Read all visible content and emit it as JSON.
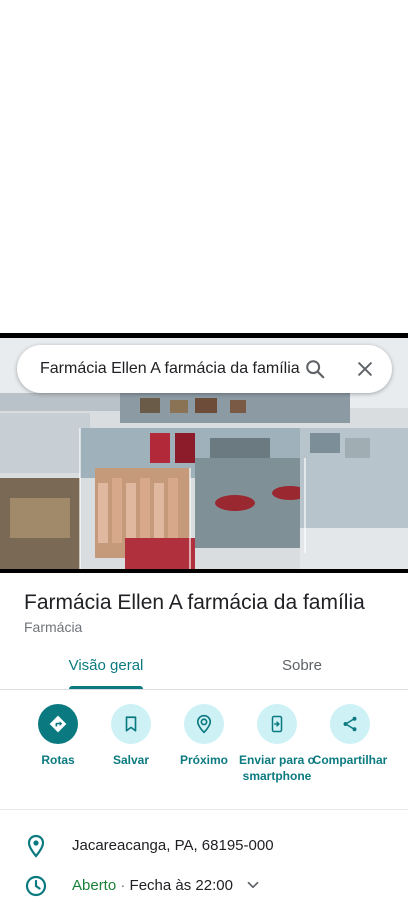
{
  "search": {
    "query": "Farmácia Ellen A farmácia da família",
    "search_icon": "search-icon",
    "close_icon": "close-icon"
  },
  "place": {
    "name": "Farmácia Ellen A farmácia da família",
    "category": "Farmácia"
  },
  "tabs": [
    {
      "label": "Visão geral",
      "active": true
    },
    {
      "label": "Sobre",
      "active": false
    }
  ],
  "actions": [
    {
      "label": "Rotas",
      "icon": "directions-icon"
    },
    {
      "label": "Salvar",
      "icon": "bookmark-icon"
    },
    {
      "label": "Próximo",
      "icon": "nearby-icon"
    },
    {
      "label": "Enviar para o smartphone",
      "icon": "send-to-phone-icon"
    },
    {
      "label": "Compartilhar",
      "icon": "share-icon"
    }
  ],
  "info": {
    "address": "Jacareacanga, PA, 68195-000",
    "hours_status": "Aberto",
    "hours_separator": " · ",
    "hours_detail": "Fecha às 22:00"
  },
  "colors": {
    "accent": "#0b7a80",
    "action_bg": "#cdf1f5",
    "open": "#188038"
  }
}
